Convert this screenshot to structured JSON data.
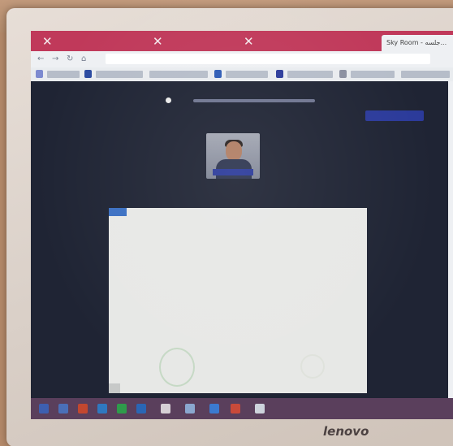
{
  "photo": {
    "subject": "laptop-screen-video-meeting",
    "brand_label": "lenovo",
    "colors": {
      "tab_strip": "#c0395a",
      "app_background": "#1f2434",
      "accent_blue": "#2b3a9a",
      "share_button": "#3a8de6"
    }
  },
  "browser": {
    "active_tab_label": "Sky Room - جلسه..."
  }
}
